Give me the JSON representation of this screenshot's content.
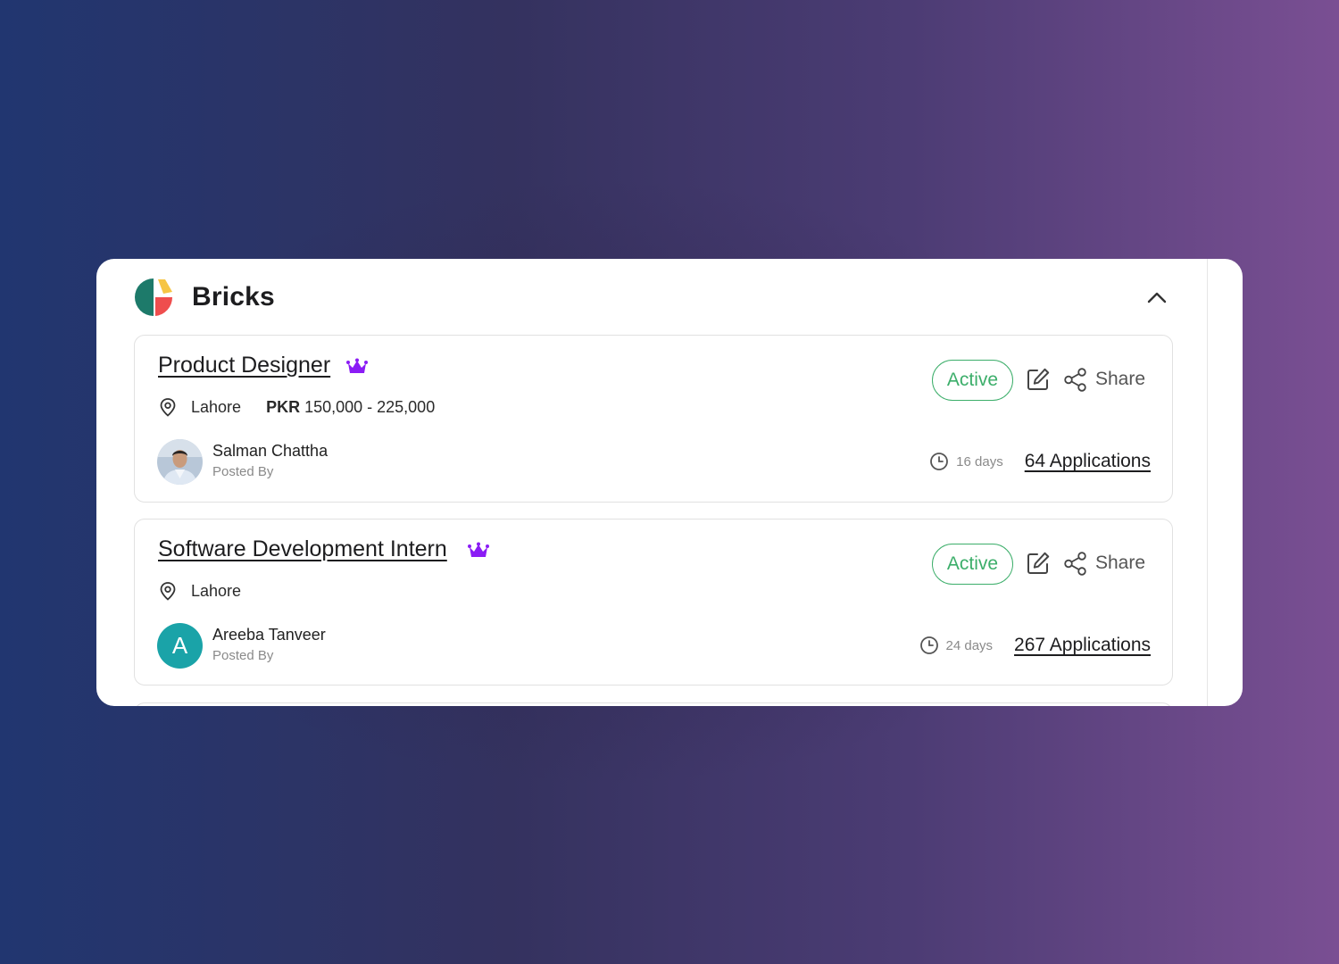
{
  "company": {
    "name": "Bricks",
    "logo_colors": {
      "green": "#1d7a6a",
      "yellow": "#f6c544",
      "red": "#ef4e4e"
    }
  },
  "jobs": [
    {
      "title": "Product Designer",
      "premium_icon": "crown-icon",
      "location": "Lahore",
      "salary_currency": "PKR",
      "salary_range": "150,000 -  225,000",
      "poster_name": "Salman Chattha",
      "poster_role": "Posted By",
      "status": "Active",
      "share_label": "Share",
      "age": "16 days",
      "applications": "64 Applications"
    },
    {
      "title": "Software Development Intern",
      "premium_icon": "crown-icon",
      "location": "Lahore",
      "poster_name": "Areeba Tanveer",
      "poster_initial": "A",
      "poster_role": "Posted By",
      "status": "Active",
      "share_label": "Share",
      "age": "24 days",
      "applications": "267 Applications"
    }
  ],
  "colors": {
    "status_green": "#3cae6a",
    "premium_purple": "#8b1cf5",
    "avatar_teal": "#1aa3a8"
  }
}
